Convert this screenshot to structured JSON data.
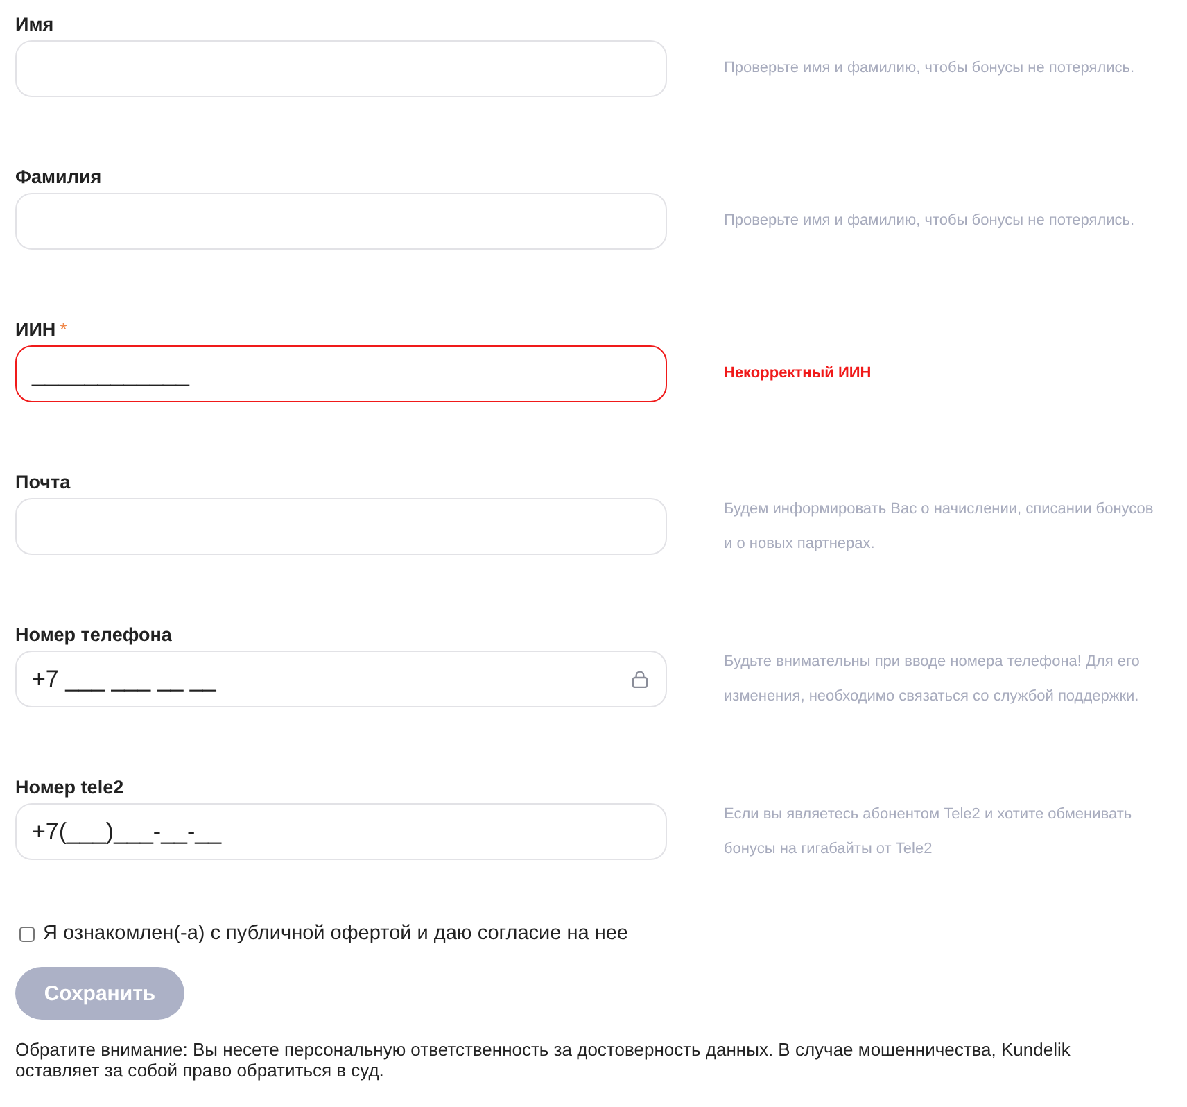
{
  "fields": [
    {
      "label": "Имя",
      "required": false,
      "hint": "Проверьте имя и фамилию, чтобы бонусы не потерялись.",
      "invalid": false,
      "locked": false
    },
    {
      "label": "Фамилия",
      "required": false,
      "hint": "Проверьте имя и фамилию, чтобы бонусы не потерялись.",
      "invalid": false,
      "locked": false
    },
    {
      "label": "ИИН",
      "required": true,
      "value": "____________",
      "hint": "Некорректный ИИН",
      "invalid": true,
      "locked": false
    },
    {
      "label": "Почта",
      "required": false,
      "hint": "Будем информировать Вас о начислении, списании бонусов и о новых партнерах.",
      "invalid": false,
      "locked": false
    },
    {
      "label": "Номер телефона",
      "required": false,
      "value": "+7 ___ ___ __ __",
      "hint": "Будьте внимательны при вводе номера телефона! Для его изменения, необходимо связаться со службой поддержки.",
      "invalid": false,
      "locked": true
    },
    {
      "label": "Номер tele2",
      "required": false,
      "value": "+7(___)___-__-__",
      "hint": "Если вы являетесь абонентом Tele2 и хотите обменивать бонусы на гигабайты от Tele2",
      "invalid": false,
      "locked": false
    }
  ],
  "required_mark": "*",
  "consent": {
    "label": "Я ознакомлен(-а) с публичной офертой и даю согласие на нее",
    "checked": false
  },
  "save_button": {
    "label": "Сохранить",
    "disabled": true
  },
  "notice": "Обратите внимание: Вы несете персональную ответственность за достоверность данных. В случае мошенничества, Kundelik оставляет за собой право обратиться в суд."
}
